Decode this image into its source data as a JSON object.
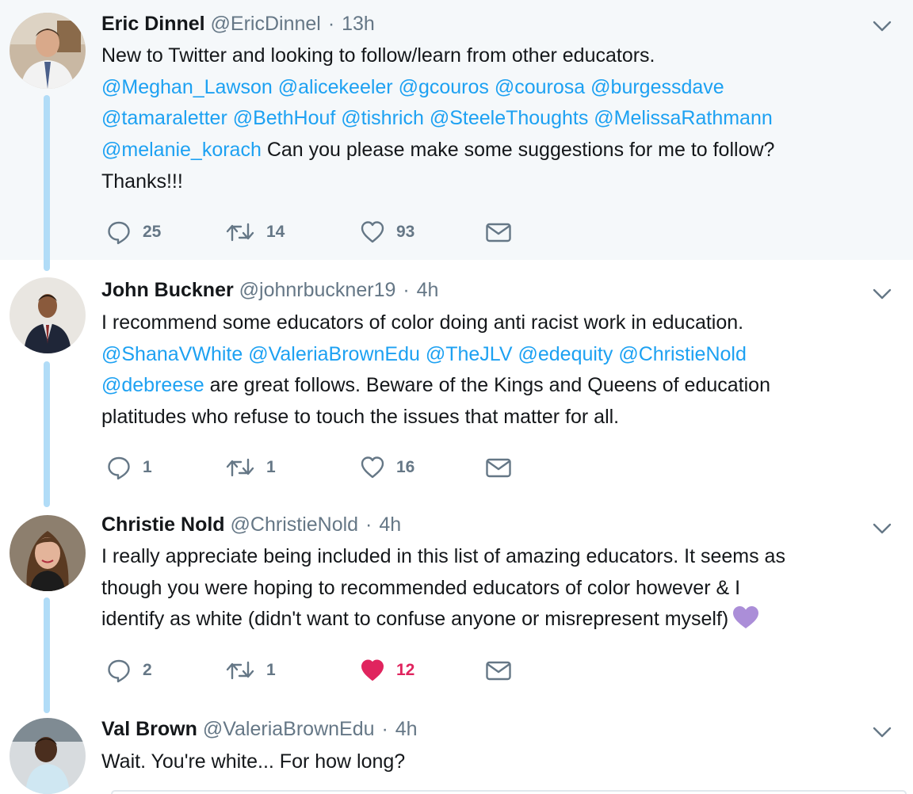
{
  "tweets": [
    {
      "name": "Eric Dinnel",
      "handle": "@EricDinnel",
      "separator": "·",
      "time": "13h",
      "segments": [
        {
          "t": "New to Twitter and looking to follow/learn from other educators."
        },
        {
          "t": "@Meghan_Lawson",
          "m": true
        },
        {
          "t": " "
        },
        {
          "t": "@alicekeeler",
          "m": true
        },
        {
          "t": " "
        },
        {
          "t": "@gcouros",
          "m": true
        },
        {
          "t": " "
        },
        {
          "t": "@courosa",
          "m": true
        },
        {
          "t": " "
        },
        {
          "t": "@burgessdave",
          "m": true
        },
        {
          "t": "@tamaraletter",
          "m": true
        },
        {
          "t": " "
        },
        {
          "t": "@BethHouf",
          "m": true
        },
        {
          "t": " "
        },
        {
          "t": "@tishrich",
          "m": true
        },
        {
          "t": " "
        },
        {
          "t": "@SteeleThoughts",
          "m": true
        },
        {
          "t": " "
        },
        {
          "t": "@MelissaRathmann",
          "m": true
        },
        {
          "t": "@melanie_korach",
          "m": true
        },
        {
          "t": " Can you please make some suggestions for me to follow?"
        },
        {
          "t": "Thanks!!!"
        }
      ],
      "replies": "25",
      "retweets": "14",
      "likes": "93",
      "liked": false
    },
    {
      "name": "John Buckner",
      "handle": "@johnrbuckner19",
      "separator": "·",
      "time": "4h",
      "segments": [
        {
          "t": "I recommend some educators of color doing anti racist work in education."
        },
        {
          "t": "@ShanaVWhite",
          "m": true
        },
        {
          "t": " "
        },
        {
          "t": "@ValeriaBrownEdu",
          "m": true
        },
        {
          "t": " "
        },
        {
          "t": "@TheJLV",
          "m": true
        },
        {
          "t": " "
        },
        {
          "t": "@edequity",
          "m": true
        },
        {
          "t": " "
        },
        {
          "t": "@ChristieNold",
          "m": true
        },
        {
          "t": "@debreese",
          "m": true
        },
        {
          "t": " are great follows. Beware of the Kings and Queens of education"
        },
        {
          "t": "platitudes who refuse to touch the issues that matter for all."
        }
      ],
      "replies": "1",
      "retweets": "1",
      "likes": "16",
      "liked": false
    },
    {
      "name": "Christie Nold",
      "handle": "@ChristieNold",
      "separator": "·",
      "time": "4h",
      "segments": [
        {
          "t": "I really appreciate being included in this list of amazing educators. It seems as"
        },
        {
          "t": "though you were hoping to recommended educators of color however & I"
        },
        {
          "t": "identify as white (didn't want to confuse anyone or misrepresent myself)"
        }
      ],
      "replies": "2",
      "retweets": "1",
      "likes": "12",
      "liked": true
    },
    {
      "name": "Val Brown",
      "handle": "@ValeriaBrownEdu",
      "separator": "·",
      "time": "4h",
      "segments": [
        {
          "t": "Wait. You're white... For how long?"
        }
      ]
    }
  ],
  "icons": {
    "reply": "reply-icon",
    "retweet": "retweet-icon",
    "like": "heart-icon",
    "message": "envelope-icon",
    "caret": "chevron-down-icon",
    "emoji": "purple-heart-icon"
  },
  "colors": {
    "mention": "#1da1f2",
    "like_active": "#e0245e",
    "thread_line": "#b1dcf7",
    "highlight_bg": "#f5f8fa",
    "secondary_text": "#657786",
    "purple_heart": "#ab8ed8"
  }
}
